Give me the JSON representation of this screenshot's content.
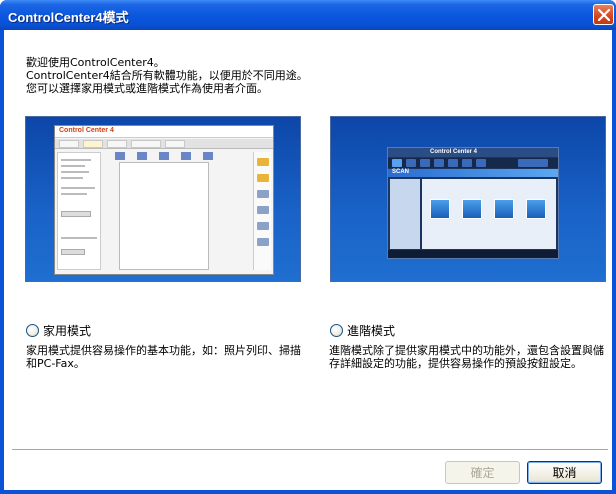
{
  "window": {
    "title": "ControlCenter4模式"
  },
  "intro": {
    "line1": "歡迎使用ControlCenter4。",
    "line2": "ControlCenter4結合所有軟體功能，以便用於不同用途。",
    "line3": "您可以選擇家用模式或進階模式作為使用者介面。"
  },
  "preview_home": {
    "logo": "Control Center 4"
  },
  "preview_advanced": {
    "logo": "Control Center 4",
    "header": "SCAN"
  },
  "options": [
    {
      "label": "家用模式",
      "description": "家用模式提供容易操作的基本功能，如：照片列印、掃描和PC-Fax。",
      "selected": false
    },
    {
      "label": "進階模式",
      "description": "進階模式除了提供家用模式中的功能外，還包含設置與儲存詳細設定的功能，提供容易操作的預設按鈕設定。",
      "selected": false
    }
  ],
  "buttons": {
    "ok": "確定",
    "cancel": "取消",
    "ok_enabled": false
  },
  "colors": {
    "title_bar": "#0a58df",
    "client_bg": "#ffffff",
    "preview_bg": "#1a63c8"
  }
}
